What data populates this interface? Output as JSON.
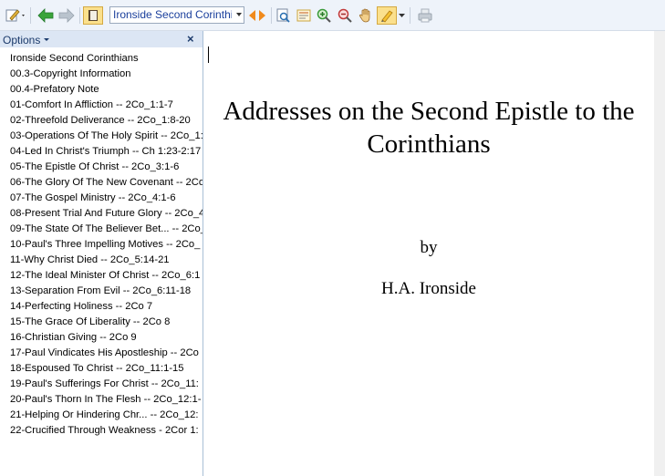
{
  "toolbar": {
    "book_selector_value": "Ironside Second Corinthi"
  },
  "sidebar": {
    "options_label": "Options",
    "close_glyph": "×",
    "items": [
      "Ironside Second Corinthians",
      "00.3-Copyright Information",
      "00.4-Prefatory Note",
      "01-Comfort In Affliction -- 2Co_1:1-7",
      "02-Threefold Deliverance -- 2Co_1:8-20",
      "03-Operations Of The Holy Spirit -- 2Co_1:",
      "04-Led In Christ's Triumph -- Ch 1:23-2:17",
      "05-The Epistle Of Christ -- 2Co_3:1-6",
      "06-The Glory Of The New Covenant -- 2Co",
      "07-The Gospel Ministry -- 2Co_4:1-6",
      "08-Present Trial And Future Glory -- 2Co_4",
      "09-The State Of The Believer Bet... -- 2Co_",
      "10-Paul's Three Impelling Motives -- 2Co_",
      "11-Why Christ Died -- 2Co_5:14-21",
      "12-The Ideal Minister Of Christ -- 2Co_6:1",
      "13-Separation From Evil -- 2Co_6:11-18",
      "14-Perfecting Holiness -- 2Co 7",
      "15-The Grace Of Liberality -- 2Co 8",
      "16-Christian Giving -- 2Co 9",
      "17-Paul Vindicates His Apostleship -- 2Co",
      "18-Espoused To Christ -- 2Co_11:1-15",
      "19-Paul's Sufferings For Christ -- 2Co_11:",
      "20-Paul's Thorn In The Flesh -- 2Co_12:1-",
      "21-Helping Or Hindering Chr... -- 2Co_12:",
      "22-Crucified Through Weakness - 2Cor 1:"
    ]
  },
  "document": {
    "title": "Addresses on the Second Epistle to the Corinthians",
    "by": "by",
    "author": "H.A. Ironside"
  },
  "colors": {
    "toolbar_bg": "#eef3fa",
    "sidebar_header_bg": "#dce6f4",
    "accent_blue": "#1a3f9c",
    "nav_arrow_green": "#3aa43a",
    "nav_arrow_orange": "#f08a1c"
  }
}
